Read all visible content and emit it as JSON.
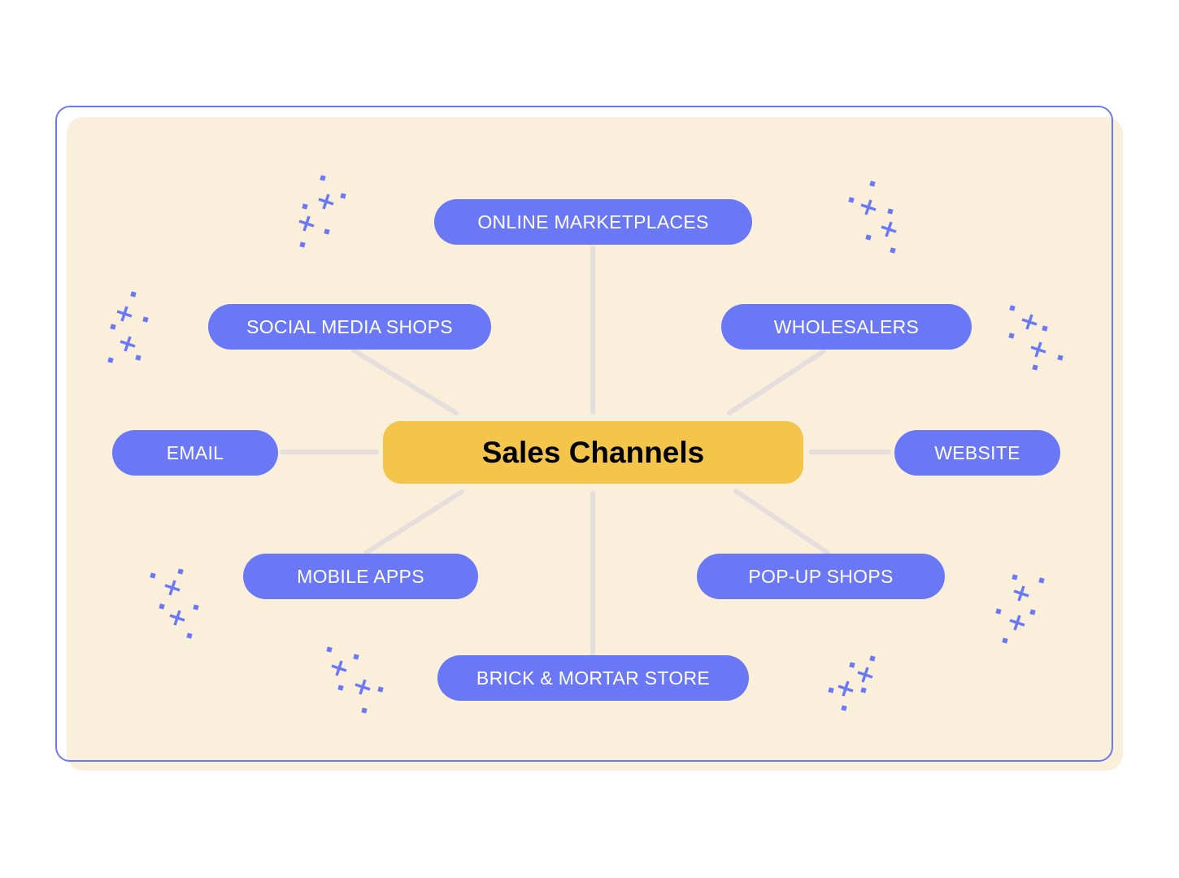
{
  "diagram": {
    "center": "Sales Channels",
    "nodes": {
      "online_marketplaces": "ONLINE MARKETPLACES",
      "social_media_shops": "SOCIAL MEDIA SHOPS",
      "wholesalers": "WHOLESALERS",
      "email": "EMAIL",
      "website": "WEBSITE",
      "mobile_apps": "MOBILE APPS",
      "pop_up_shops": "POP-UP SHOPS",
      "brick_mortar_store": "BRICK & MORTAR STORE"
    },
    "colors": {
      "node": "#6b78f5",
      "center": "#f3c54a",
      "background": "#faefdb",
      "connector": "#e6dedc",
      "frame": "#6e78f0"
    }
  }
}
